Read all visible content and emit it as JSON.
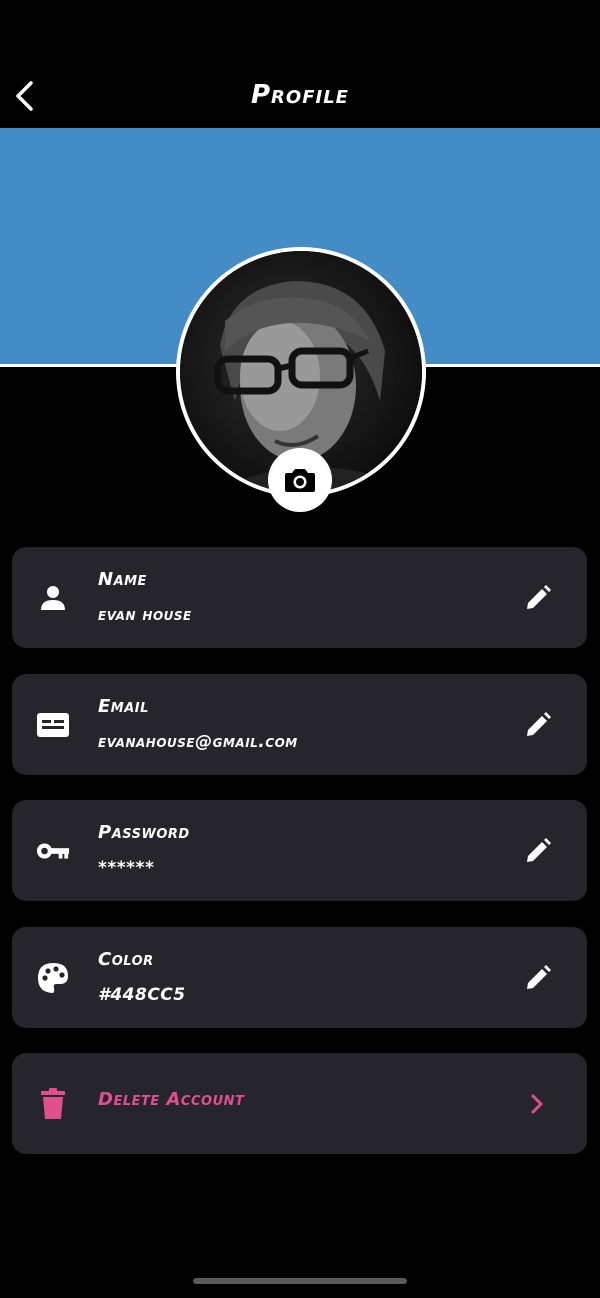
{
  "header": {
    "title": "Profile",
    "back_icon": "chevron-left-icon"
  },
  "colors": {
    "accent": "#448CC5",
    "card": "#25252b",
    "danger": "#e0508f",
    "background": "#000000"
  },
  "avatar": {
    "camera_icon": "camera-icon"
  },
  "fields": [
    {
      "label": "Name",
      "value": "evan house",
      "icon": "person-icon"
    },
    {
      "label": "Email",
      "value": "evanahouse@gmail.com",
      "icon": "id-card-icon"
    },
    {
      "label": "Password",
      "value": "******",
      "icon": "key-icon"
    },
    {
      "label": "Color",
      "value": "#448CC5",
      "icon": "palette-icon"
    }
  ],
  "delete": {
    "label": "Delete Account",
    "icon": "trash-icon"
  }
}
